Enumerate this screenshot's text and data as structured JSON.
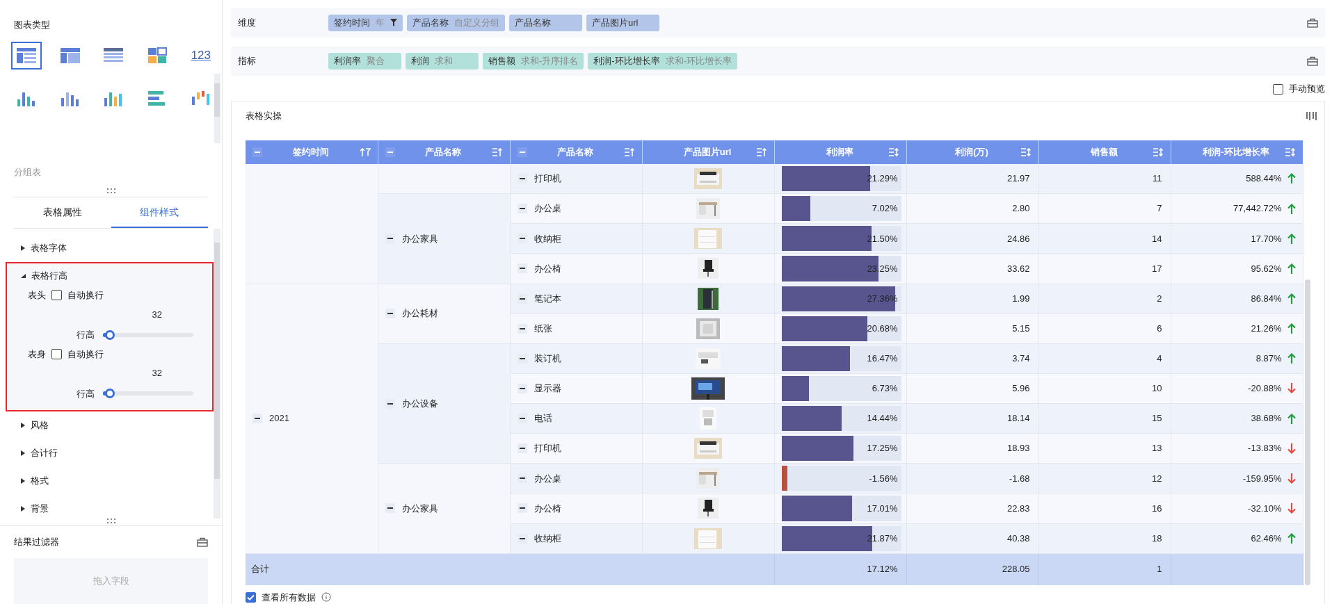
{
  "sidebar": {
    "chart_types_title": "图表类型",
    "chart_types": [
      {
        "kind": "group-table",
        "selected": true
      },
      {
        "kind": "cross-table",
        "selected": false
      },
      {
        "kind": "detail-table",
        "selected": false
      },
      {
        "kind": "blocks",
        "selected": false
      },
      {
        "kind": "number",
        "text": "123",
        "selected": false
      },
      {
        "kind": "dot-bars",
        "selected": false
      },
      {
        "kind": "bars",
        "selected": false
      },
      {
        "kind": "color-bars",
        "selected": false
      },
      {
        "kind": "bar-list",
        "selected": false
      },
      {
        "kind": "float-bars",
        "selected": false
      }
    ],
    "chart_name": "分组表",
    "tabs": [
      {
        "label": "表格属性",
        "selected": false
      },
      {
        "label": "组件样式",
        "selected": true
      }
    ],
    "sections": [
      {
        "label": "表格字体",
        "expanded": false,
        "highlighted": false
      },
      {
        "label": "表格行高",
        "expanded": true,
        "highlighted": true,
        "groups": [
          {
            "label": "表头",
            "checkbox": {
              "label": "自动换行",
              "checked": false
            },
            "value": "32",
            "slider_label": "行高",
            "level": 0.04
          },
          {
            "label": "表身",
            "checkbox": {
              "label": "自动换行",
              "checked": false
            },
            "value": "32",
            "slider_label": "行高",
            "level": 0.04
          }
        ]
      },
      {
        "label": "风格",
        "expanded": false,
        "highlighted": false
      },
      {
        "label": "合计行",
        "expanded": false,
        "highlighted": false
      },
      {
        "label": "格式",
        "expanded": false,
        "highlighted": false
      },
      {
        "label": "背景",
        "expanded": false,
        "highlighted": false
      }
    ],
    "filter": {
      "title": "结果过滤器",
      "placeholder": "拖入字段"
    }
  },
  "fields": [
    {
      "kind": "dimension",
      "label": "维度",
      "tags": [
        {
          "name": "签约时间",
          "detail": "年",
          "filter": true
        },
        {
          "name": "产品名称",
          "detail": "自定义分组",
          "filter": false
        },
        {
          "name": "产品名称",
          "filter": false
        },
        {
          "name": "产品图片url",
          "filter": false
        }
      ]
    },
    {
      "kind": "measure",
      "label": "指标",
      "tags": [
        {
          "name": "利润率",
          "detail": "聚合",
          "filter": false
        },
        {
          "name": "利润",
          "detail": "求和",
          "filter": false
        },
        {
          "name": "销售额",
          "detail": "求和-升序排名",
          "filter": false
        },
        {
          "name": "利润-环比增长率",
          "detail": "求和-环比增长率",
          "filter": false
        }
      ]
    }
  ],
  "manual_preview": {
    "label": "手动预览",
    "checked": false
  },
  "table": {
    "title": "表格实操",
    "columns": [
      {
        "label": "签约时间",
        "collapsible": true,
        "kind": "up-filter"
      },
      {
        "label": "产品名称",
        "collapsible": true,
        "kind": "up"
      },
      {
        "label": "产品名称",
        "collapsible": true,
        "kind": "up"
      },
      {
        "label": "产品图片url",
        "collapsible": false,
        "kind": "up"
      },
      {
        "label": "利润率",
        "collapsible": false,
        "kind": "updown"
      },
      {
        "label": "利润(万)",
        "collapsible": false,
        "kind": "updown"
      },
      {
        "label": "销售额",
        "collapsible": false,
        "kind": "updown"
      },
      {
        "label": "利润-环比增长率",
        "collapsible": false,
        "kind": "updown"
      }
    ],
    "row_groups": [
      {
        "children": [
          {
            "children": [
              {
                "name": "打印机",
                "profit_rate": "21.29%",
                "level": 0.74,
                "color": "#58558e",
                "profit": "21.97",
                "sales": "11",
                "growth": "588.44%",
                "rising": true
              }
            ]
          },
          {
            "label": "办公家具",
            "children": [
              {
                "name": "办公桌",
                "profit_rate": "7.02%",
                "level": 0.24,
                "color": "#58558e",
                "profit": "2.80",
                "sales": "7",
                "growth": "77,442.72%",
                "rising": true
              },
              {
                "name": "收纳柜",
                "profit_rate": "21.50%",
                "level": 0.75,
                "color": "#58558e",
                "profit": "24.86",
                "sales": "14",
                "growth": "17.70%",
                "rising": true
              },
              {
                "name": "办公椅",
                "profit_rate": "23.25%",
                "level": 0.81,
                "color": "#58558e",
                "profit": "33.62",
                "sales": "17",
                "growth": "95.62%",
                "rising": true
              }
            ]
          }
        ]
      },
      {
        "label": "2021",
        "children": [
          {
            "label": "办公耗材",
            "children": [
              {
                "name": "笔记本",
                "profit_rate": "27.36%",
                "level": 0.95,
                "color": "#58558e",
                "profit": "1.99",
                "sales": "2",
                "growth": "86.84%",
                "rising": true
              },
              {
                "name": "纸张",
                "profit_rate": "20.68%",
                "level": 0.72,
                "color": "#58558e",
                "profit": "5.15",
                "sales": "6",
                "growth": "21.26%",
                "rising": true
              }
            ]
          },
          {
            "label": "办公设备",
            "children": [
              {
                "name": "装订机",
                "profit_rate": "16.47%",
                "level": 0.57,
                "color": "#58558e",
                "profit": "3.74",
                "sales": "4",
                "growth": "8.87%",
                "rising": true
              },
              {
                "name": "显示器",
                "profit_rate": "6.73%",
                "level": 0.23,
                "color": "#58558e",
                "profit": "5.96",
                "sales": "10",
                "growth": "-20.88%",
                "rising": false
              },
              {
                "name": "电话",
                "profit_rate": "14.44%",
                "level": 0.5,
                "color": "#58558e",
                "profit": "18.14",
                "sales": "15",
                "growth": "38.68%",
                "rising": true
              },
              {
                "name": "打印机",
                "profit_rate": "17.25%",
                "level": 0.6,
                "color": "#58558e",
                "profit": "18.93",
                "sales": "13",
                "growth": "-13.83%",
                "rising": false
              }
            ]
          },
          {
            "label": "办公家具",
            "children": [
              {
                "name": "办公桌",
                "profit_rate": "-1.56%",
                "level": 0.05,
                "color": "#b5523f",
                "profit": "-1.68",
                "sales": "12",
                "growth": "-159.95%",
                "rising": false
              },
              {
                "name": "办公椅",
                "profit_rate": "17.01%",
                "level": 0.59,
                "color": "#58558e",
                "profit": "22.83",
                "sales": "16",
                "growth": "-32.10%",
                "rising": false
              },
              {
                "name": "收纳柜",
                "profit_rate": "21.87%",
                "level": 0.76,
                "color": "#58558e",
                "profit": "40.38",
                "sales": "18",
                "growth": "62.46%",
                "rising": true
              }
            ]
          }
        ]
      }
    ],
    "summary": {
      "label": "合计",
      "profit_rate": "17.12%",
      "profit": "228.05",
      "sales": "1"
    }
  },
  "show_all": {
    "label": "查看所有数据",
    "checked": true
  }
}
